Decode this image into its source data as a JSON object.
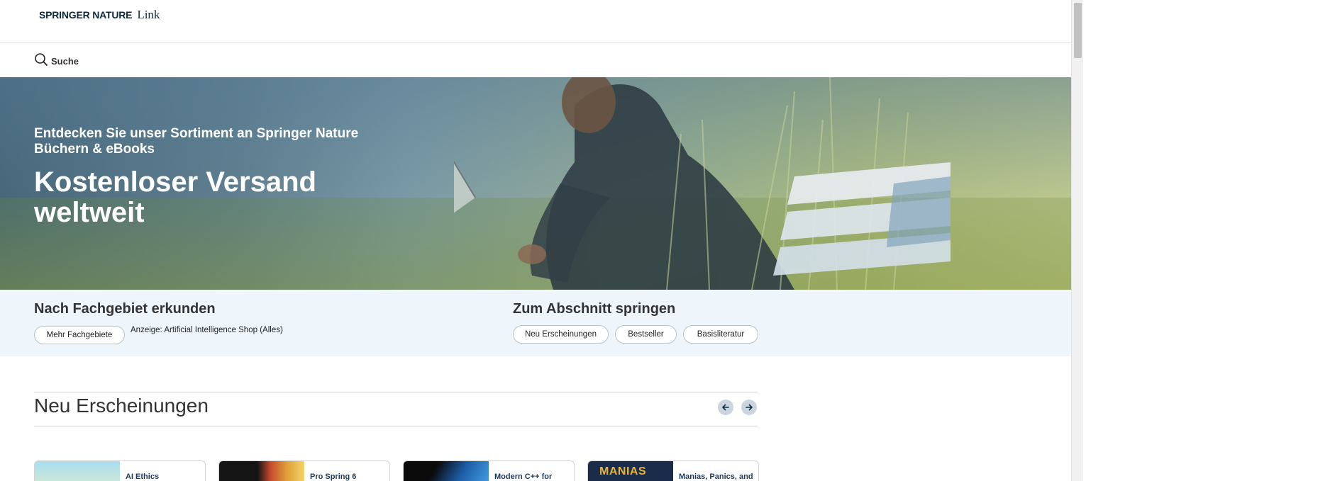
{
  "header": {
    "brand": "SPRINGER NATURE",
    "product": "Link"
  },
  "search": {
    "label": "Suche"
  },
  "hero": {
    "subtitle": "Entdecken Sie unser Sortiment an Springer Nature Büchern & eBooks",
    "title": "Kostenloser Versand weltweit"
  },
  "explore": {
    "heading": "Nach Fachgebiet erkunden",
    "more_button": "Mehr Fachgebiete",
    "ad_link": "Anzeige: Artificial Intelligence Shop (Alles)"
  },
  "jump": {
    "heading": "Zum Abschnitt springen",
    "links": [
      "Neu Erscheinungen",
      "Bestseller",
      "Basisliteratur"
    ]
  },
  "new_releases": {
    "heading": "Neu Erscheinungen",
    "books": [
      {
        "title": "AI Ethics",
        "cover_color": "#8fd0e8"
      },
      {
        "title": "Pro Spring 6",
        "cover_color": "#1a1a1a"
      },
      {
        "title": "Modern C++ for",
        "cover_color": "#1c5fa8"
      },
      {
        "title": "Manias, Panics, and",
        "cover_color": "#1b2b4a",
        "cover_text": "MANIAS"
      }
    ]
  },
  "colors": {
    "band_background": "#eef5fb",
    "brand_navy": "#0d2a3c",
    "arrow_button": "#c9d6de"
  },
  "icons": {
    "search": "search-icon",
    "prev": "arrow-left-icon",
    "next": "arrow-right-icon"
  }
}
